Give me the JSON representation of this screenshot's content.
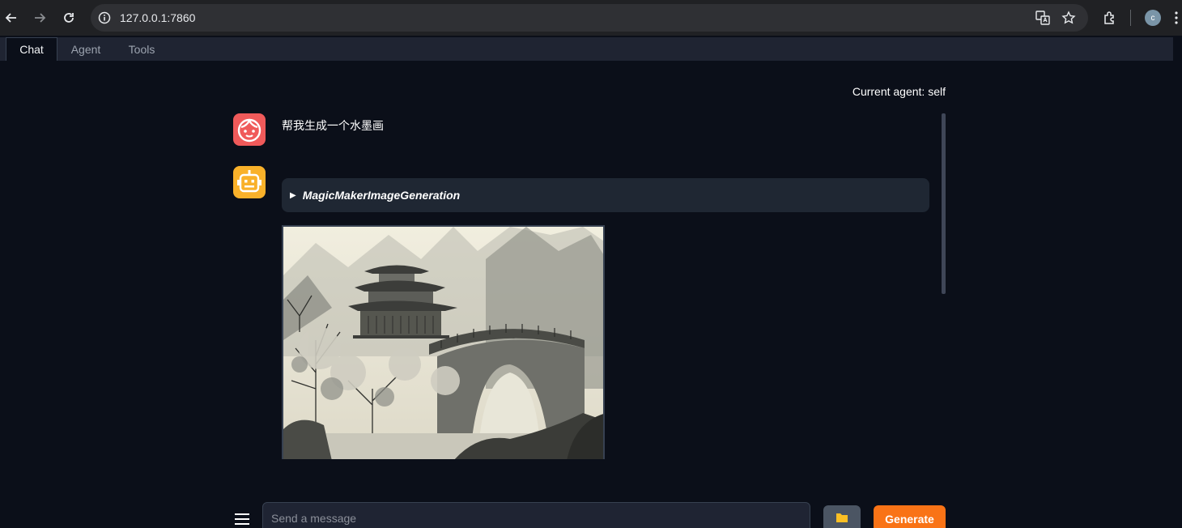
{
  "browser": {
    "url": "127.0.0.1:7860",
    "profile_initial": "c",
    "icons": [
      "back-icon",
      "forward-icon",
      "reload-icon",
      "site-info-icon",
      "translate-icon",
      "star-icon",
      "extensions-icon",
      "kebab-menu-icon"
    ]
  },
  "tabs": [
    {
      "label": "Chat",
      "active": true
    },
    {
      "label": "Agent",
      "active": false
    },
    {
      "label": "Tools",
      "active": false
    }
  ],
  "header": {
    "current_agent": "Current agent: self"
  },
  "messages": [
    {
      "role": "user",
      "avatar_icon": "user-face-icon",
      "text": "帮我生成一个水墨画"
    },
    {
      "role": "bot",
      "avatar_icon": "robot-icon",
      "tool_call": "MagicMakerImageGeneration",
      "image": "ink-wash-painting"
    }
  ],
  "input": {
    "placeholder": "Send a message",
    "value": ""
  },
  "buttons": {
    "upload_icon": "folder-icon",
    "generate": "Generate",
    "menu_icon": "menu-icon"
  },
  "colors": {
    "background": "#0b0f19",
    "accent": "#f97316",
    "user_avatar": "#f05a5a",
    "bot_avatar": "#f9b12a"
  }
}
